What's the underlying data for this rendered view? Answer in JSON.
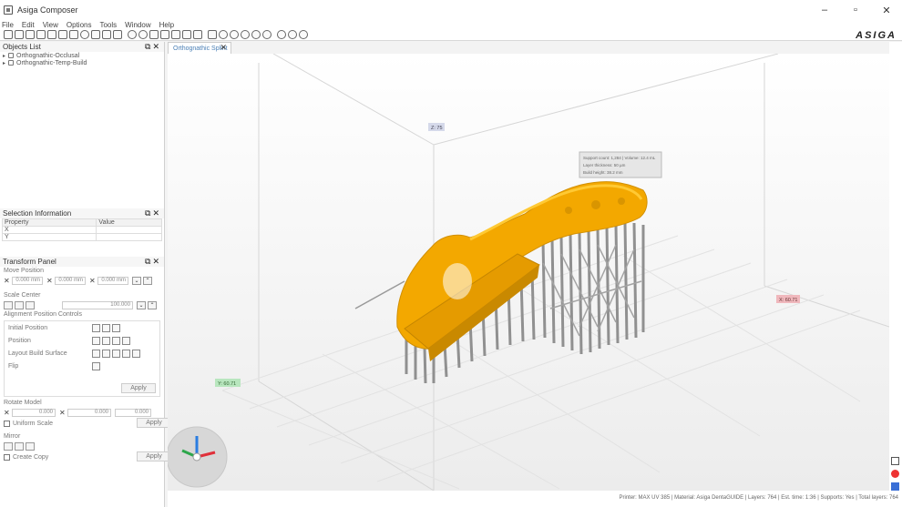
{
  "window": {
    "title": "Asiga Composer",
    "minimize": "–",
    "maximize": "▫",
    "close": "✕"
  },
  "menu": [
    "File",
    "Edit",
    "View",
    "Options",
    "Tools",
    "Window",
    "Help"
  ],
  "brand": {
    "logo_text": "ASIGA"
  },
  "objects_panel": {
    "title": "Objects List",
    "items": [
      {
        "label": "Orthognathic-Occlusal"
      },
      {
        "label": "Orthognathic-Temp-Build"
      }
    ]
  },
  "properties_panel": {
    "title": "Selection Information",
    "columns": [
      "Property",
      "Value"
    ],
    "rows": [
      {
        "property": "X",
        "value": ""
      },
      {
        "property": "Y",
        "value": ""
      }
    ]
  },
  "transform_panel": {
    "title": "Transform Panel",
    "translate_label": "Move Position",
    "translate": {
      "x": "0.000 mm",
      "y": "0.000 mm",
      "z": "0.000 mm"
    },
    "scale_label": "Scale Center",
    "scale_value": "100.000",
    "group_label": "Alignment Position Controls",
    "group_rows": [
      "Initial Position",
      "Position",
      "Layout Build Surface",
      "Flip"
    ],
    "apply_label": "Apply",
    "rotate_label": "Rotate Model",
    "rotate": {
      "x": "0.000",
      "y": "0.000",
      "z": "0.000"
    },
    "uniform_label": "Uniform Scale",
    "uniform_apply": "Apply",
    "mirror_label": "Mirror",
    "create_copy_label": "Create Copy",
    "create_copy_apply": "Apply"
  },
  "viewport": {
    "tab_label": "Orthognathic Splint",
    "axis_z_label": "Z: 75",
    "axis_x_label": "X: 60.71",
    "axis_y_label": "Y: 60.71",
    "tooltip_lines": [
      "Support count: 1,284 | Volume: 12.4 mL",
      "Layer thickness: 50 µm",
      "Build height: 38.2 mm"
    ]
  },
  "status": {
    "text": "Printer: MAX UV 385 | Material: Asiga DentaGUIDE | Layers: 764 | Est. time: 1:36 | Supports: Yes | Total layers: 764"
  },
  "colors": {
    "model": "#f3a800",
    "model_shadow": "#c98900",
    "support": "#8f8f8f",
    "grid": "#dcdcdc"
  }
}
